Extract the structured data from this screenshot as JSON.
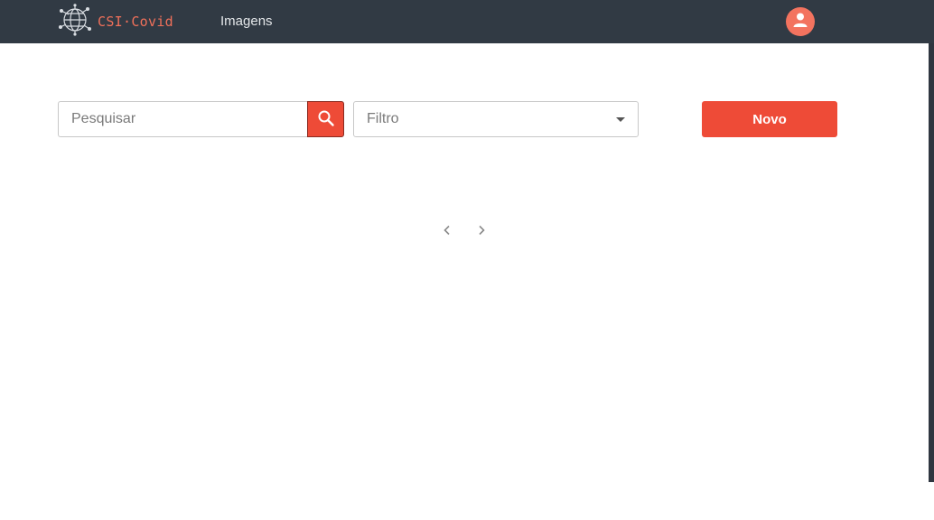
{
  "navbar": {
    "brand": "CSI·Covid",
    "links": [
      {
        "label": "Imagens"
      }
    ],
    "user_icon": "user-avatar-icon"
  },
  "toolbar": {
    "search_placeholder": "Pesquisar",
    "search_icon": "search-icon",
    "filter_placeholder": "Filtro",
    "new_label": "Novo"
  },
  "pagination": {
    "prev_icon": "chevron-left-icon",
    "next_icon": "chevron-right-icon"
  },
  "colors": {
    "navbar": "#313a44",
    "accent": "#ee4b37",
    "brand": "#f0705a"
  }
}
